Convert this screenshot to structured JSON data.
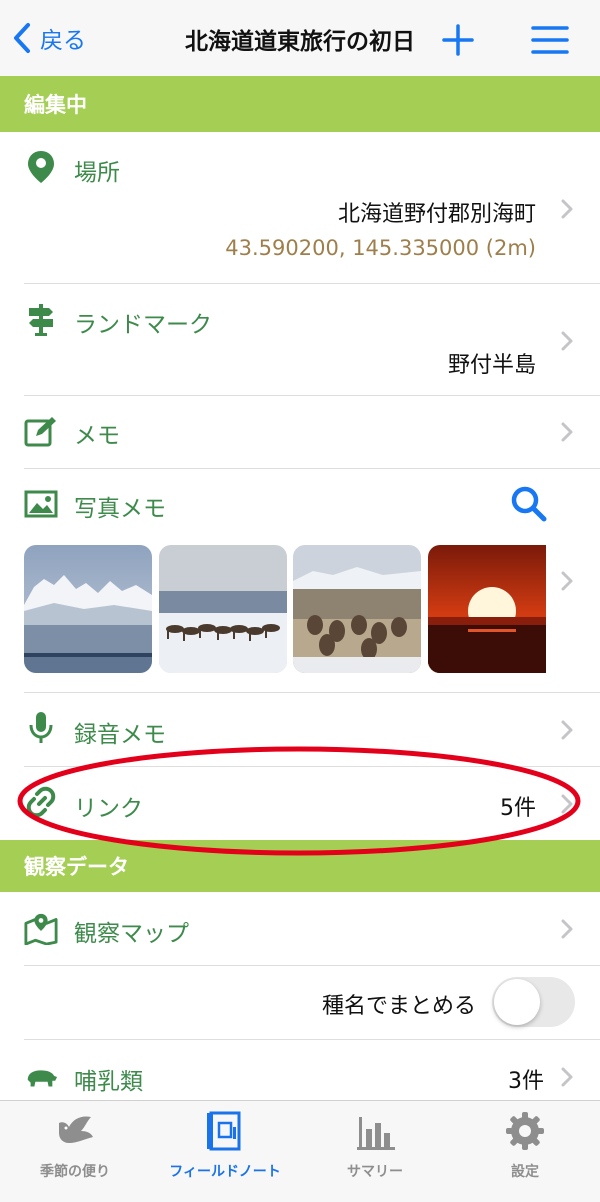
{
  "nav": {
    "back_label": "戻る",
    "title": "北海道道東旅行の初日"
  },
  "sections": {
    "editing": "編集中",
    "observation": "観察データ"
  },
  "location": {
    "label": "場所",
    "address": "北海道野付郡別海町",
    "coords": "43.590200, 145.335000 (2m)"
  },
  "landmark": {
    "label": "ランドマーク",
    "value": "野付半島"
  },
  "memo": {
    "label": "メモ"
  },
  "photo_memo": {
    "label": "写真メモ"
  },
  "voice_memo": {
    "label": "録音メモ"
  },
  "link": {
    "label": "リンク",
    "count": "5件"
  },
  "observation_map": {
    "label": "観察マップ"
  },
  "group_by_species": {
    "label": "種名でまとめる",
    "enabled": false
  },
  "mammals": {
    "label": "哺乳類",
    "count": "3件"
  },
  "tabs": [
    {
      "label": "季節の便り",
      "icon": "bird-icon",
      "active": false
    },
    {
      "label": "フィールドノート",
      "icon": "notebook-icon",
      "active": true
    },
    {
      "label": "サマリー",
      "icon": "bar-chart-icon",
      "active": false
    },
    {
      "label": "設定",
      "icon": "gear-icon",
      "active": false
    }
  ],
  "colors": {
    "accent_green": "#a4ce54",
    "label_green": "#3d8a4b",
    "ios_blue": "#1877f2",
    "coords_brown": "#9e7f4c",
    "highlight_red": "#e3001b"
  }
}
